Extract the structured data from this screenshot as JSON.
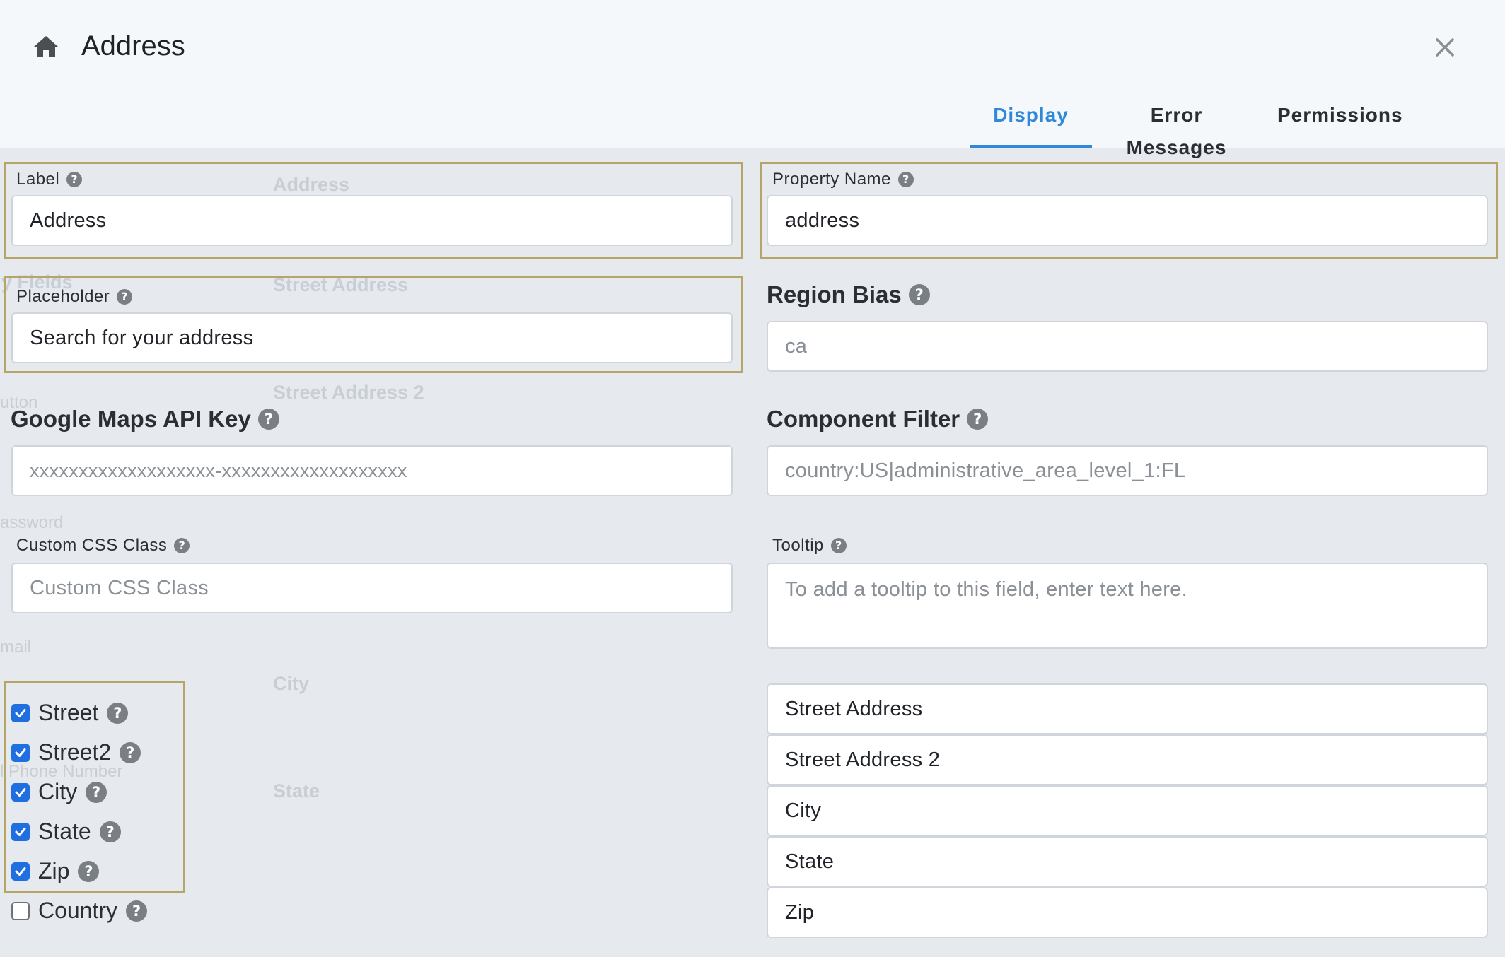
{
  "header": {
    "title": "Address",
    "tabs": [
      {
        "label": "Display",
        "active": true
      },
      {
        "label": "Error Messages",
        "active": false
      },
      {
        "label": "Permissions",
        "active": false
      }
    ]
  },
  "background_labels": {
    "address": "Address",
    "street_address": "Street Address",
    "street_address_2": "Street Address 2",
    "city": "City",
    "state": "State",
    "phone_number": "l Phone Number",
    "button": "utton",
    "password": "assword",
    "email": "mail",
    "fields": "y Fields"
  },
  "form": {
    "label": {
      "label": "Label",
      "value": "Address"
    },
    "property_name": {
      "label": "Property Name",
      "value": "address"
    },
    "placeholder": {
      "label": "Placeholder",
      "value": "Search for your address"
    },
    "region_bias": {
      "label": "Region Bias",
      "placeholder": "ca"
    },
    "api_key": {
      "label": "Google Maps API Key",
      "placeholder": "xxxxxxxxxxxxxxxxxxx-xxxxxxxxxxxxxxxxxxx"
    },
    "component_filter": {
      "label": "Component Filter",
      "placeholder": "country:US|administrative_area_level_1:FL"
    },
    "css_class": {
      "label": "Custom CSS Class",
      "placeholder": "Custom CSS Class"
    },
    "tooltip": {
      "label": "Tooltip",
      "placeholder": "To add a tooltip to this field, enter text here."
    }
  },
  "checkboxes": [
    {
      "label": "Street",
      "checked": true
    },
    {
      "label": "Street2",
      "checked": true
    },
    {
      "label": "City",
      "checked": true
    },
    {
      "label": "State",
      "checked": true
    },
    {
      "label": "Zip",
      "checked": true
    },
    {
      "label": "Country",
      "checked": false
    }
  ],
  "sub_fields": [
    {
      "value": "Street Address"
    },
    {
      "value": "Street Address 2"
    },
    {
      "value": "City"
    },
    {
      "value": "State"
    },
    {
      "value": "Zip"
    }
  ],
  "colors": {
    "accent": "#2f88d8",
    "highlight": "#b5a566",
    "checkbox": "#1f6fe0"
  }
}
